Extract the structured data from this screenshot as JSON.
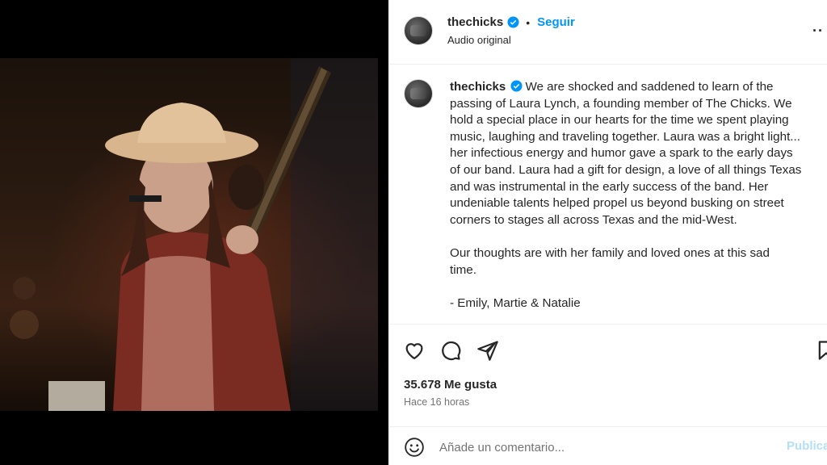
{
  "media": {
    "mute_icon": "speaker-muted-icon"
  },
  "post": {
    "username": "thechicks",
    "follow_separator": "•",
    "follow_label": "Seguir",
    "audio_label": "Audio original",
    "more_icon": "more-dots-icon",
    "verified_color": "#0095f6"
  },
  "caption": {
    "username": "thechicks",
    "lines": [
      "We are shocked and saddened to learn of the",
      "passing of Laura Lynch, a founding member of The Chicks. We",
      "hold a special place in our hearts for the time we spent playing",
      "music, laughing and traveling together. Laura was a bright light...",
      "her infectious energy and humor gave a spark to the early days",
      "of our band.  Laura had a gift for design, a love of all things Texas",
      "and was instrumental in the early success of the band. Her",
      "undeniable talents helped propel us beyond busking on street",
      "corners to stages all across Texas and the mid-West."
    ],
    "lines2": [
      "Our thoughts are with her family and loved ones at this sad",
      "time."
    ],
    "signature": "- Emily, Martie & Natalie"
  },
  "actions": {
    "like_icon": "heart-icon",
    "comment_icon": "comment-bubble-icon",
    "share_icon": "paper-plane-icon",
    "save_icon": "bookmark-icon"
  },
  "stats": {
    "likes": "35.678 Me gusta",
    "time_ago": "Hace 16 horas"
  },
  "comment": {
    "emoji_icon": "smiley-icon",
    "placeholder": "Añade un comentario...",
    "publish_label": "Publicar",
    "publish_color": "#b2dffc"
  }
}
